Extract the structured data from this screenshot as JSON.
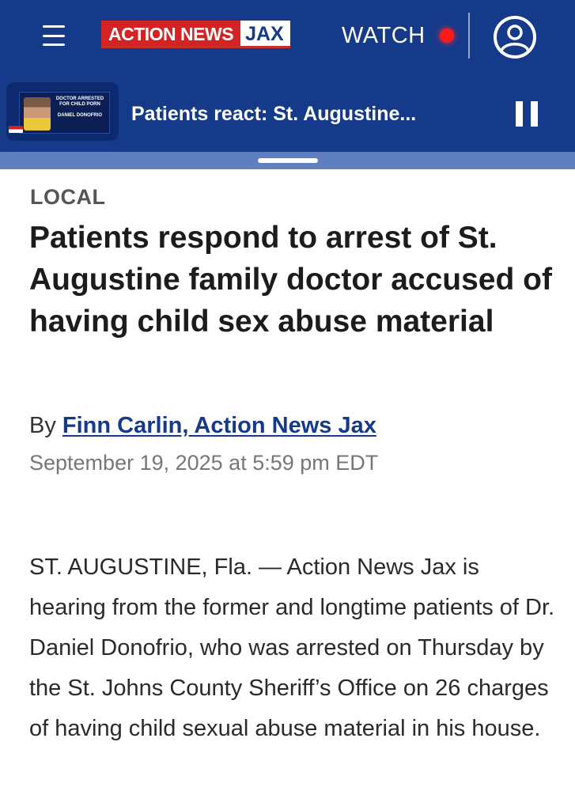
{
  "header": {
    "logo_main": "ACTION NEWS",
    "logo_sub": "JAX",
    "watch_label": "WATCH",
    "colors": {
      "nav_bg": "#163a8a",
      "logo_red": "#d42323",
      "live_dot": "#ff1a1a"
    },
    "icons": {
      "menu": "hamburger-menu-icon",
      "account": "user-account-icon",
      "live": "live-dot-icon"
    }
  },
  "video": {
    "thumbnail_headline": "DOCTOR ARRESTED FOR CHILD PORN",
    "thumbnail_name": "DANIEL DONOFRIO",
    "title": "Patients react: St. Augustine...",
    "control_icon": "pause-icon"
  },
  "article": {
    "section": "LOCAL",
    "headline": "Patients respond to arrest of St. Augustine family doctor accused of having child sex abuse material",
    "byline_prefix": "By",
    "author": "Finn Carlin, Action News Jax",
    "date": "September 19, 2025 at 5:59 pm EDT",
    "body": "ST. AUGUSTINE, Fla. — Action News Jax is hearing from the former and longtime patients of Dr. Daniel Donofrio, who was arrested on Thursday by the St. Johns County Sheriff’s Office on 26 charges of having child sexual abuse material in his house."
  }
}
